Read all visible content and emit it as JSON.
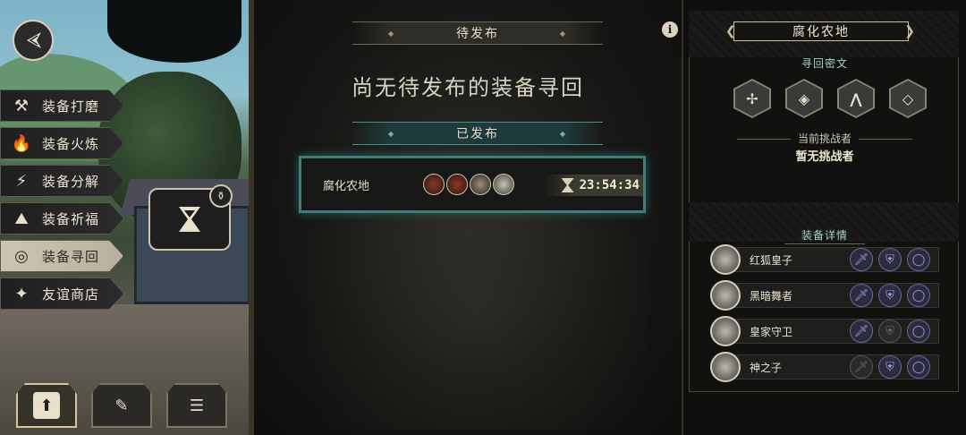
{
  "left_menu": {
    "items": [
      {
        "label": "装备打磨",
        "icon": "hammer-icon",
        "glyph": "⚒",
        "active": false
      },
      {
        "label": "装备火炼",
        "icon": "flame-icon",
        "glyph": "🔥",
        "active": false
      },
      {
        "label": "装备分解",
        "icon": "decompose-icon",
        "glyph": "⚡",
        "active": false
      },
      {
        "label": "装备祈福",
        "icon": "pray-icon",
        "glyph": "⛰",
        "active": false
      },
      {
        "label": "装备寻回",
        "icon": "retrieve-icon",
        "glyph": "◎",
        "active": true
      },
      {
        "label": "友谊商店",
        "icon": "fox-shop-icon",
        "glyph": "✦",
        "active": false
      }
    ]
  },
  "bottom_buttons": [
    {
      "icon": "upload-icon",
      "glyph": "⬆",
      "active": true
    },
    {
      "icon": "feather-icon",
      "glyph": "✎",
      "active": false
    },
    {
      "icon": "list-icon",
      "glyph": "☰",
      "active": false
    }
  ],
  "center": {
    "pending_title": "待发布",
    "empty_message": "尚无待发布的装备寻回",
    "published_title": "已发布",
    "quest": {
      "name": "腐化农地",
      "timer": "23:54:34"
    },
    "info_glyph": "i"
  },
  "right": {
    "title": "腐化农地",
    "secret_label": "寻回密文",
    "secret_glyphs": [
      "✢",
      "◈",
      "⋀",
      "◇"
    ],
    "challenger_label": "当前挑战者",
    "challenger_value": "暂无挑战者",
    "details_label": "装备详情",
    "heroes": [
      {
        "name": "红狐皇子",
        "slots": [
          true,
          true,
          true
        ]
      },
      {
        "name": "黑暗舞者",
        "slots": [
          true,
          true,
          true
        ]
      },
      {
        "name": "皇家守卫",
        "slots": [
          true,
          false,
          true
        ]
      },
      {
        "name": "神之子",
        "slots": [
          false,
          true,
          true
        ]
      }
    ]
  },
  "colors": {
    "accent_teal": "#3f7d7a",
    "slot_purple": "#a99ce0",
    "gold_border": "#cbbf9d"
  }
}
